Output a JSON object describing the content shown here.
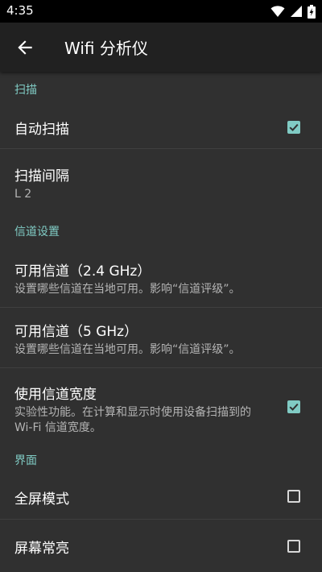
{
  "status_bar": {
    "time": "4:35",
    "icons": [
      "wifi-icon",
      "signal-icon",
      "battery-charging-icon"
    ]
  },
  "app_bar": {
    "back_icon": "arrow-back-icon",
    "title": "Wifi 分析仪"
  },
  "sections": {
    "scan": {
      "header": "扫描",
      "auto_scan": {
        "title": "自动扫描",
        "checked": true
      },
      "scan_interval": {
        "title": "扫描间隔",
        "summary": "L 2"
      }
    },
    "channel": {
      "header": "信道设置",
      "ch24": {
        "title": "可用信道（2.4 GHz）",
        "summary": "设置哪些信道在当地可用。影响“信道评级”。"
      },
      "ch5": {
        "title": "可用信道（5 GHz）",
        "summary": "设置哪些信道在当地可用。影响“信道评级”。"
      },
      "width": {
        "title": "使用信道宽度",
        "summary": "实验性功能。在计算和显示时使用设备扫描到的 Wi-Fi 信道宽度。",
        "checked": true
      }
    },
    "ui": {
      "header": "界面",
      "fullscreen": {
        "title": "全屏模式",
        "checked": false
      },
      "screen_on": {
        "title": "屏幕常亮",
        "checked": false
      }
    }
  },
  "colors": {
    "accent": "#80cbc4",
    "background": "#303030",
    "app_bar": "#212121",
    "status_bar": "#000000"
  }
}
